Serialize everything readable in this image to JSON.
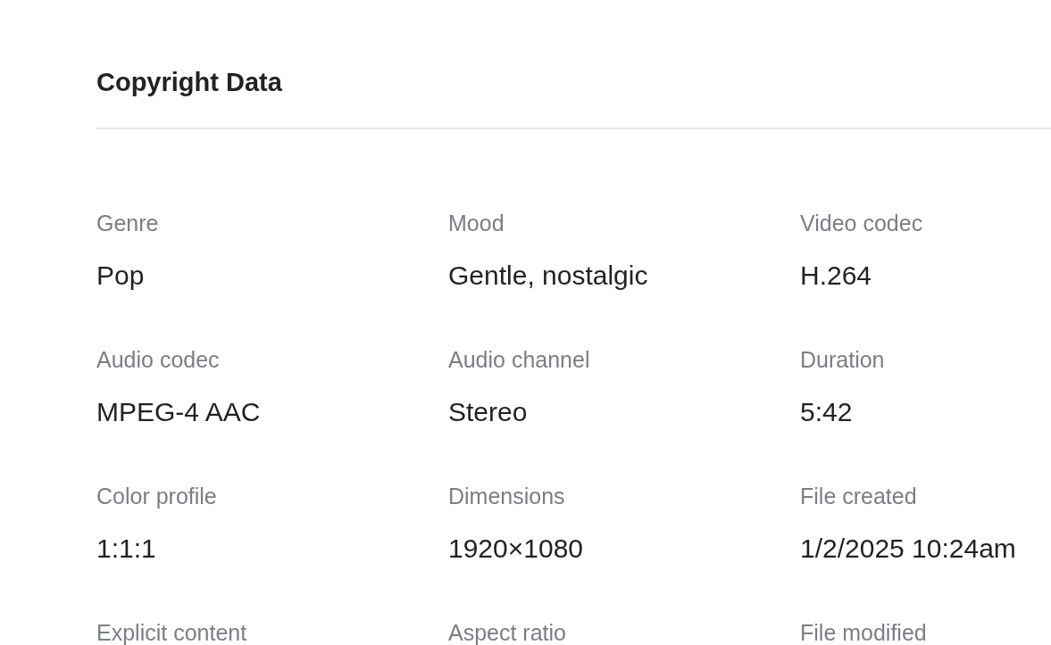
{
  "section": {
    "title": "Copyright Data"
  },
  "fields": [
    {
      "label": "Genre",
      "value": "Pop"
    },
    {
      "label": "Mood",
      "value": "Gentle, nostalgic"
    },
    {
      "label": "Video codec",
      "value": "H.264"
    },
    {
      "label": "Audio codec",
      "value": "MPEG-4 AAC"
    },
    {
      "label": "Audio channel",
      "value": "Stereo"
    },
    {
      "label": "Duration",
      "value": "5:42"
    },
    {
      "label": "Color profile",
      "value": "1:1:1"
    },
    {
      "label": "Dimensions",
      "value": "1920×1080"
    },
    {
      "label": "File created",
      "value": "1/2/2025 10:24am"
    },
    {
      "label": "Explicit content"
    },
    {
      "label": "Aspect ratio"
    },
    {
      "label": "File modified"
    }
  ]
}
